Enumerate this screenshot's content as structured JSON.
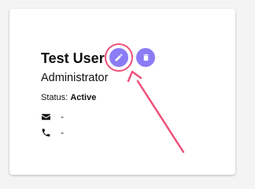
{
  "user": {
    "name": "Test User",
    "role": "Administrator",
    "status_label": "Status:",
    "status_value": "Active",
    "email": "-",
    "phone": "-"
  },
  "icons": {
    "edit": "pencil-icon",
    "delete": "trash-icon",
    "email": "envelope-icon",
    "phone": "phone-icon"
  },
  "colors": {
    "action_button": "#8b7cf6",
    "annotation": "#f0507a",
    "text": "#111111"
  }
}
